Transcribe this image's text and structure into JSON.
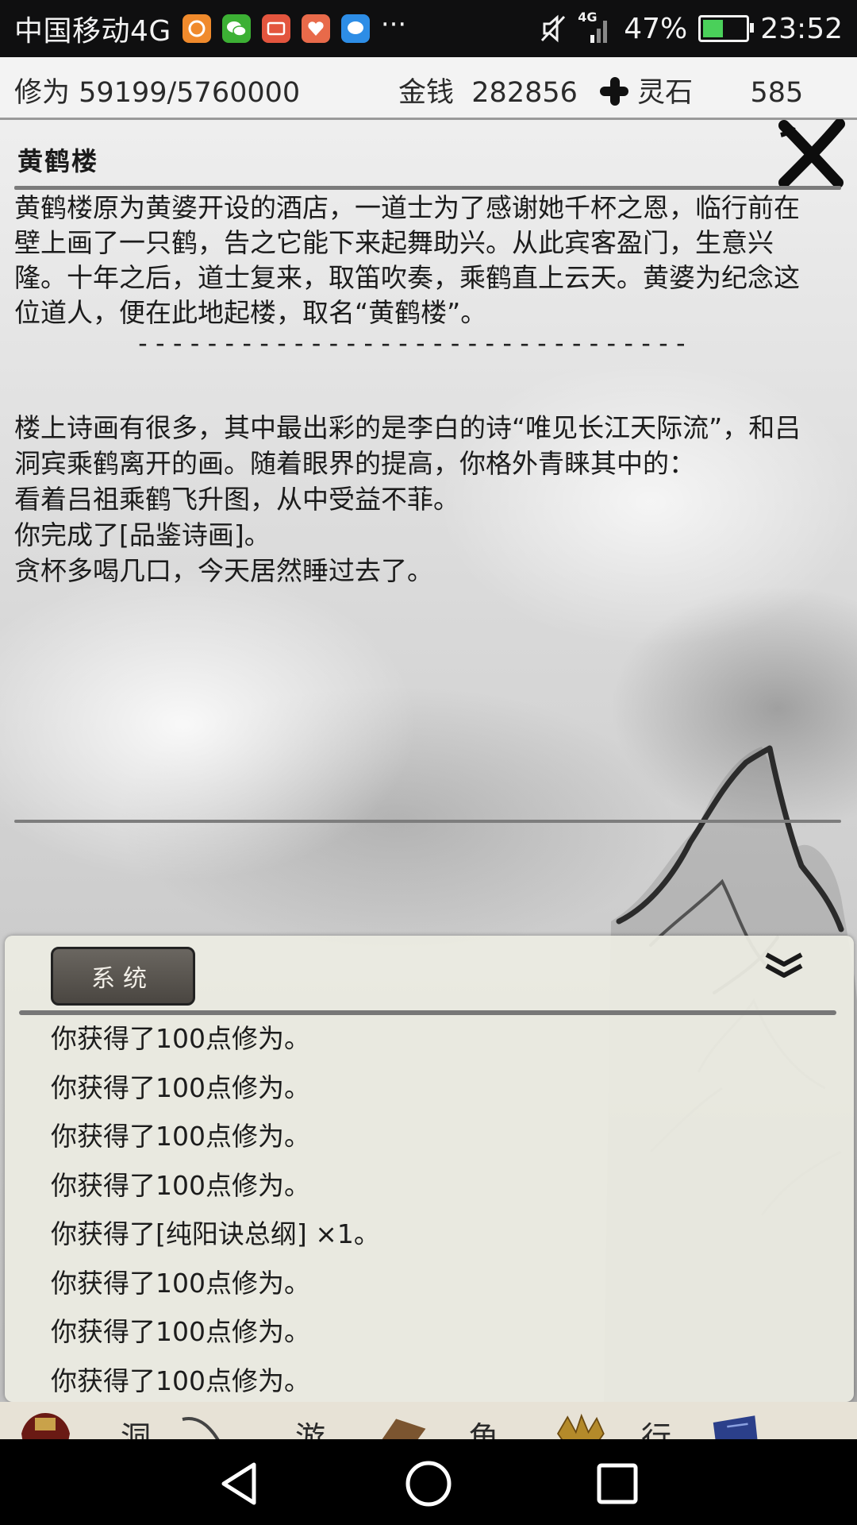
{
  "status_bar": {
    "carrier": "中国移动4G",
    "network": "4G",
    "battery": "47%",
    "battery_level": 0.47,
    "time": "23:52"
  },
  "top_stats": {
    "cultivation_label": "修为",
    "cultivation_value": "59199/5760000",
    "money_label": "金钱",
    "money_value": "282856",
    "stone_label": "灵石",
    "stone_value": "585"
  },
  "location": {
    "title": "黄鹤楼",
    "description": "黄鹤楼原为黄婆开设的酒店，一道士为了感谢她千杯之恩，临行前在壁上画了一只鹤，告之它能下来起舞助兴。从此宾客盈门，生意兴隆。十年之后，道士复来，取笛吹奏，乘鹤直上云天。黄婆为纪念这位道人，便在此地起楼，取名“黄鹤楼”。",
    "separator": "--------------------------------"
  },
  "result": [
    "楼上诗画有很多，其中最出彩的是李白的诗“唯见长江天际流”，和吕洞宾乘鹤离开的画。随着眼界的提高，你格外青睐其中的：",
    "看着吕祖乘鹤飞升图，从中受益不菲。",
    "你完成了[品鉴诗画]。",
    "贪杯多喝几口，今天居然睡过去了。"
  ],
  "log_panel": {
    "tab_label": "系统",
    "messages": [
      "你获得了100点修为。",
      "你获得了100点修为。",
      "你获得了100点修为。",
      "你获得了100点修为。",
      "你获得了[纯阳诀总纲] ×1。",
      "你获得了100点修为。",
      "你获得了100点修为。",
      "你获得了100点修为。"
    ]
  },
  "bottom_nav": {
    "items": [
      "洞",
      "游",
      "角",
      "行"
    ]
  }
}
